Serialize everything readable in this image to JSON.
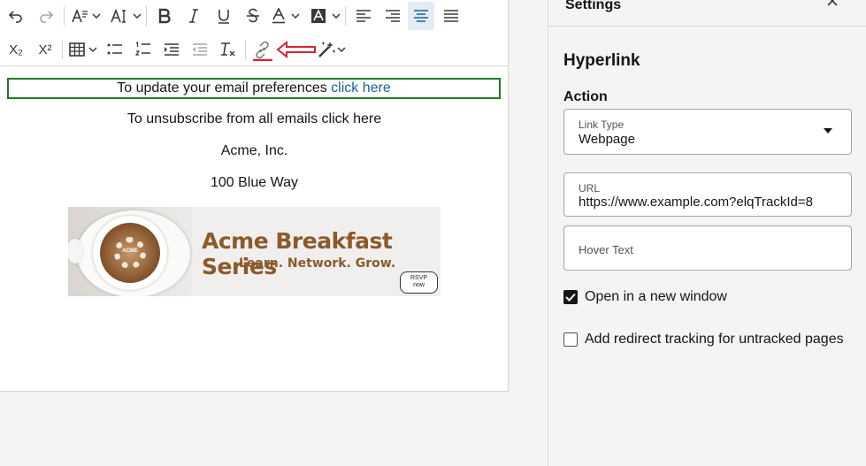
{
  "toolbar": {
    "undo_icon": "undo-icon",
    "redo_icon": "redo-icon",
    "font_family_icon": "font-family-icon",
    "font_size_icon": "font-size-icon",
    "bold_icon": "bold-icon",
    "italic_icon": "italic-icon",
    "underline_icon": "underline-icon",
    "strikethrough_icon": "strikethrough-icon",
    "text_color_icon": "text-color-icon",
    "highlight_icon": "highlight-icon",
    "align_left_icon": "align-left-icon",
    "align_right_icon": "align-right-icon",
    "align_center_icon": "align-center-icon",
    "justify_icon": "justify-icon",
    "subscript_label": "X₂",
    "superscript_label": "X²",
    "table_icon": "table-icon",
    "bullet_list_icon": "bullet-list-icon",
    "numbered_list_icon": "numbered-list-icon",
    "indent_icon": "indent-icon",
    "outdent_icon": "outdent-icon",
    "clear_format_icon": "clear-format-icon",
    "link_icon": "link-icon",
    "annotation_arrow": "red-arrow-icon",
    "magic_icon": "magic-wand-icon"
  },
  "content": {
    "line1_text": "To update your email preferences ",
    "line1_link": "click here",
    "line2": "To unsubscribe from all emails click here",
    "line3": "Acme, Inc.",
    "line4": "100 Blue Way",
    "banner": {
      "title": "Acme Breakfast Series",
      "subtitle": "Learn. Network. Grow.",
      "rsvp_line1": "RSVP",
      "rsvp_line2": "now",
      "logo_text": "ACME"
    }
  },
  "panel": {
    "title": "Settings",
    "close_icon": "close-icon",
    "section_title": "Hyperlink",
    "action_label": "Action",
    "link_type": {
      "label": "Link Type",
      "value": "Webpage"
    },
    "url": {
      "label": "URL",
      "value": "https://www.example.com?elqTrackId=8"
    },
    "hover_text": {
      "label": "Hover Text",
      "value": ""
    },
    "open_new_window": {
      "label": "Open in a new window",
      "checked": true
    },
    "redirect_tracking": {
      "label": "Add redirect tracking for untracked pages",
      "checked": false
    }
  },
  "colors": {
    "accent_link": "#1b5e9e",
    "selection_border": "#1e7b1e",
    "annotation_red": "#d9232e",
    "banner_brown": "#8b5a2b"
  }
}
